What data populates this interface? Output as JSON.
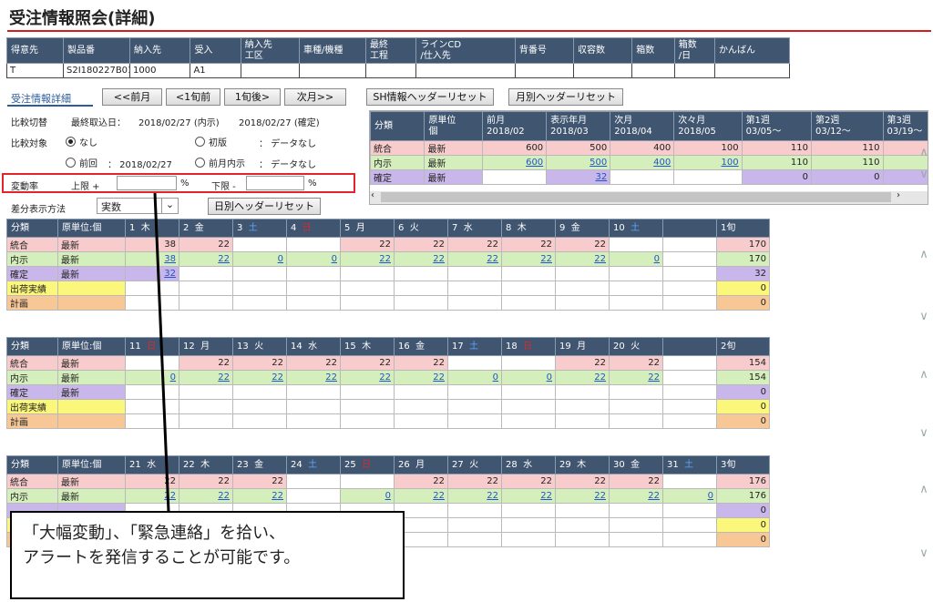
{
  "page_title": "受注情報照会(詳細)",
  "info_headers": [
    "得意先",
    "製品番",
    "納入先",
    "受入",
    "納入先\n工区",
    "車種/機種",
    "最終\n工程",
    "ラインCD\n/仕入先",
    "背番号",
    "収容数",
    "箱数",
    "箱数\n/日",
    "かんばん"
  ],
  "info_values": [
    "T",
    "S2I180227B01",
    "1000",
    "A1",
    "",
    "",
    "",
    "",
    "",
    "",
    "",
    "",
    ""
  ],
  "tab_label": "受注情報詳細",
  "nav_buttons": [
    "<<前月",
    "<1旬前",
    "1旬後>",
    "次月>>"
  ],
  "sh_reset": "SH情報ヘッダーリセット",
  "monthly_reset": "月別ヘッダーリセット",
  "daily_reset": "日別ヘッダーリセット",
  "compare_switch": {
    "label": "比較切替",
    "latest_label": "最終取込日：",
    "date1": "2018/02/27 (内示)",
    "date2": "2018/02/27 (確定)"
  },
  "compare_target": {
    "label": "比較対象",
    "opt_none": "なし",
    "opt_first": "初版",
    "opt_prev": "前回",
    "prev_date": "： 2018/02/27",
    "opt_prev_month": "前月内示",
    "no_data": "： データなし"
  },
  "change_rate": {
    "label": "変動率",
    "upper": "上限 +",
    "lower": "下限 -",
    "pct": "%"
  },
  "diff_method": {
    "label": "差分表示方法",
    "value": "実数"
  },
  "monthly": {
    "headers": [
      "分類",
      "原単位\n個",
      "前月\n2018/02",
      "表示年月\n2018/03",
      "次月\n2018/04",
      "次々月\n2018/05",
      "第1週\n03/05～",
      "第2週\n03/12～",
      "第3週\n03/19～"
    ],
    "rows": [
      {
        "cls": "pink",
        "cat": "統合",
        "unit": "最新",
        "v": [
          "600",
          "500",
          "400",
          "100",
          "110",
          "110",
          "11"
        ],
        "link": [
          false,
          false,
          false,
          false,
          false,
          false,
          false
        ]
      },
      {
        "cls": "green",
        "cat": "内示",
        "unit": "最新",
        "v": [
          "600",
          "500",
          "400",
          "100",
          "110",
          "110",
          "11"
        ],
        "link": [
          true,
          true,
          true,
          true,
          false,
          false,
          false
        ]
      },
      {
        "cls": "purple",
        "cat": "確定",
        "unit": "最新",
        "v": [
          "",
          "32",
          "",
          "",
          "0",
          "0",
          ""
        ],
        "link": [
          false,
          true,
          false,
          false,
          false,
          false,
          false
        ]
      }
    ]
  },
  "daily_blocks": [
    {
      "days": [
        [
          "1",
          "木",
          ""
        ],
        [
          "2",
          "金",
          ""
        ],
        [
          "3",
          "土",
          "sat"
        ],
        [
          "4",
          "日",
          "sun"
        ],
        [
          "5",
          "月",
          ""
        ],
        [
          "6",
          "火",
          ""
        ],
        [
          "7",
          "水",
          ""
        ],
        [
          "8",
          "木",
          ""
        ],
        [
          "9",
          "金",
          ""
        ],
        [
          "10",
          "土",
          "sat"
        ],
        [
          "",
          "",
          " "
        ]
      ],
      "total_label": "1旬",
      "head": [
        "分類",
        "原単位:個"
      ],
      "rows": [
        {
          "cls": "pink",
          "cat": "統合",
          "unit": "最新",
          "v": [
            "38",
            "22",
            "",
            "",
            "22",
            "22",
            "22",
            "22",
            "22",
            "",
            ""
          ],
          "total": "170"
        },
        {
          "cls": "green",
          "cat": "内示",
          "unit": "最新",
          "v": [
            "38",
            "22",
            "0",
            "0",
            "22",
            "22",
            "22",
            "22",
            "22",
            "0",
            ""
          ],
          "total": "170",
          "link": true
        },
        {
          "cls": "purple",
          "cat": "確定",
          "unit": "最新",
          "v": [
            "32",
            "",
            "",
            "",
            "",
            "",
            "",
            "",
            "",
            "",
            ""
          ],
          "total": "32",
          "link": true
        },
        {
          "cls": "yellow",
          "cat": "出荷実績",
          "unit": "",
          "v": [
            "",
            "",
            "",
            "",
            "",
            "",
            "",
            "",
            "",
            "",
            ""
          ],
          "total": "0"
        },
        {
          "cls": "orange",
          "cat": "計画",
          "unit": "",
          "v": [
            "",
            "",
            "",
            "",
            "",
            "",
            "",
            "",
            "",
            "",
            ""
          ],
          "total": "0"
        }
      ]
    },
    {
      "days": [
        [
          "11",
          "日",
          "sun"
        ],
        [
          "12",
          "月",
          ""
        ],
        [
          "13",
          "火",
          ""
        ],
        [
          "14",
          "水",
          ""
        ],
        [
          "15",
          "木",
          ""
        ],
        [
          "16",
          "金",
          ""
        ],
        [
          "17",
          "土",
          "sat"
        ],
        [
          "18",
          "日",
          "sun"
        ],
        [
          "19",
          "月",
          ""
        ],
        [
          "20",
          "火",
          ""
        ],
        [
          "",
          "",
          " "
        ]
      ],
      "total_label": "2旬",
      "head": [
        "分類",
        "原単位:個"
      ],
      "rows": [
        {
          "cls": "pink",
          "cat": "統合",
          "unit": "最新",
          "v": [
            "",
            "22",
            "22",
            "22",
            "22",
            "22",
            "",
            "",
            "22",
            "22",
            ""
          ],
          "total": "154"
        },
        {
          "cls": "green",
          "cat": "内示",
          "unit": "最新",
          "v": [
            "0",
            "22",
            "22",
            "22",
            "22",
            "22",
            "0",
            "0",
            "22",
            "22",
            ""
          ],
          "total": "154",
          "link": true
        },
        {
          "cls": "purple",
          "cat": "確定",
          "unit": "最新",
          "v": [
            "",
            "",
            "",
            "",
            "",
            "",
            "",
            "",
            "",
            "",
            ""
          ],
          "total": "0"
        },
        {
          "cls": "yellow",
          "cat": "出荷実績",
          "unit": "",
          "v": [
            "",
            "",
            "",
            "",
            "",
            "",
            "",
            "",
            "",
            "",
            ""
          ],
          "total": "0"
        },
        {
          "cls": "orange",
          "cat": "計画",
          "unit": "",
          "v": [
            "",
            "",
            "",
            "",
            "",
            "",
            "",
            "",
            "",
            "",
            ""
          ],
          "total": "0"
        }
      ]
    },
    {
      "days": [
        [
          "21",
          "水",
          ""
        ],
        [
          "22",
          "木",
          ""
        ],
        [
          "23",
          "金",
          ""
        ],
        [
          "24",
          "土",
          "sat"
        ],
        [
          "25",
          "日",
          "sun"
        ],
        [
          "26",
          "月",
          ""
        ],
        [
          "27",
          "火",
          ""
        ],
        [
          "28",
          "水",
          ""
        ],
        [
          "29",
          "木",
          ""
        ],
        [
          "30",
          "金",
          ""
        ],
        [
          "31",
          "土",
          "sat"
        ]
      ],
      "total_label": "3旬",
      "head": [
        "分類",
        "原単位:個"
      ],
      "rows": [
        {
          "cls": "pink",
          "cat": "統合",
          "unit": "最新",
          "v": [
            "22",
            "22",
            "22",
            "",
            "",
            "22",
            "22",
            "22",
            "22",
            "22",
            ""
          ],
          "total": "176"
        },
        {
          "cls": "green",
          "cat": "内示",
          "unit": "最新",
          "v": [
            "22",
            "22",
            "22",
            "",
            "0",
            "22",
            "22",
            "22",
            "22",
            "22",
            "0"
          ],
          "total": "176",
          "link": true
        },
        {
          "cls": "purple",
          "cat": "",
          "unit": "",
          "v": [
            "",
            "",
            "",
            "",
            "",
            "",
            "",
            "",
            "",
            "",
            ""
          ],
          "total": "0"
        },
        {
          "cls": "yellow",
          "cat": "",
          "unit": "",
          "v": [
            "",
            "",
            "",
            "",
            "",
            "",
            "",
            "",
            "",
            "",
            ""
          ],
          "total": "0"
        },
        {
          "cls": "orange",
          "cat": "",
          "unit": "",
          "v": [
            "",
            "",
            "",
            "",
            "",
            "",
            "",
            "",
            "",
            "",
            ""
          ],
          "total": "0"
        }
      ]
    }
  ],
  "callout_line1": "「大幅変動」、「緊急連絡」を拾い、",
  "callout_line2": "アラートを発信することが可能です。",
  "icons": {
    "scroll_left": "◀",
    "scroll_right": "▶",
    "chevron_up": "∧",
    "chevron_down": "∨",
    "dropdown": "⌄"
  }
}
